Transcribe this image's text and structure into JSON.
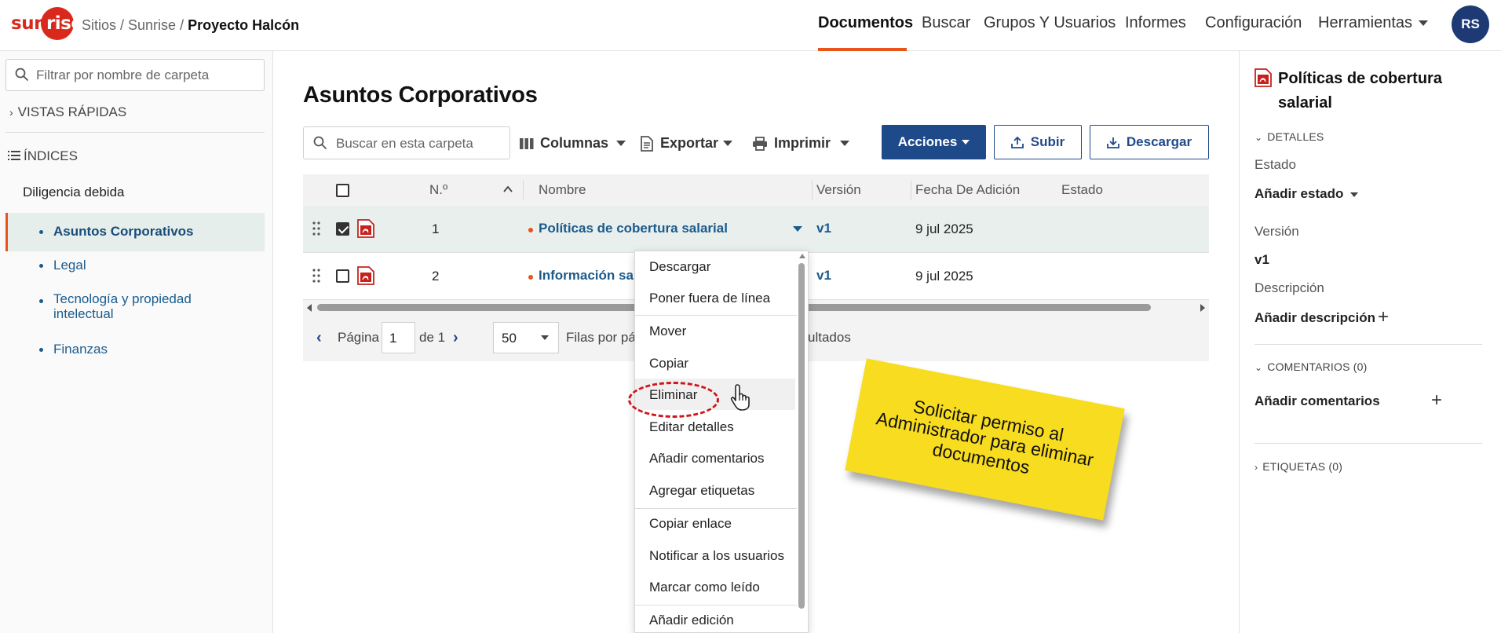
{
  "header": {
    "logo": "sunrise",
    "breadcrumb": {
      "sites": "Sitios",
      "sep1": " / ",
      "site": "Sunrise",
      "sep2": " / ",
      "current": "Proyecto Halcón"
    },
    "nav": [
      "Documentos",
      "Buscar",
      "Grupos Y Usuarios",
      "Informes",
      "Configuración",
      "Herramientas"
    ],
    "active_nav": "Documentos",
    "avatar": "RS",
    "accent_color": "#e8541a",
    "brand_color": "#d9291c"
  },
  "sidebar": {
    "filter_placeholder": "Filtrar por nombre de carpeta",
    "quick_views": "VISTAS RÁPIDAS",
    "indices": "ÍNDICES",
    "root": "Diligencia debida",
    "items": [
      "Asuntos Corporativos",
      "Legal",
      "Tecnología y propiedad intelectual",
      "Finanzas"
    ],
    "selected": "Asuntos Corporativos"
  },
  "main": {
    "title": "Asuntos Corporativos",
    "search_placeholder": "Buscar en esta carpeta",
    "toolbar": {
      "columns": "Columnas",
      "export": "Exportar",
      "print": "Imprimir",
      "actions": "Acciones",
      "upload": "Subir",
      "download": "Descargar"
    },
    "table": {
      "headers": {
        "num": "N.º",
        "name": "Nombre",
        "version": "Versión",
        "date": "Fecha De Adición",
        "status": "Estado"
      },
      "rows": [
        {
          "num": "1",
          "name": "Políticas de cobertura salarial",
          "version": "v1",
          "date": "9 jul 2025",
          "checked": true
        },
        {
          "num": "2",
          "name": "Información sal",
          "version": "v1",
          "date": "9 jul 2025",
          "checked": false
        }
      ]
    },
    "pager": {
      "page_label": "Página",
      "page": "1",
      "of": "de 1",
      "rows": "50",
      "rows_label": "Filas por pá",
      "results": "ultados"
    }
  },
  "context_menu": {
    "items": [
      "Descargar",
      "Poner fuera de línea",
      "Mover",
      "Copiar",
      "Eliminar",
      "Editar detalles",
      "Añadir comentarios",
      "Agregar etiquetas",
      "Copiar enlace",
      "Notificar a los usuarios",
      "Marcar como leído",
      "Añadir edición"
    ],
    "highlighted": "Eliminar"
  },
  "note": {
    "text": "Solicitar permiso al Administrador para eliminar documentos"
  },
  "details_panel": {
    "title": "Políticas de cobertura salarial",
    "details_section": "DETALLES",
    "status_label": "Estado",
    "status_value": "Añadir estado",
    "version_label": "Versión",
    "version_value": "v1",
    "description_label": "Descripción",
    "description_value": "Añadir descripción",
    "comments_section": "COMENTARIOS (0)",
    "comments_add": "Añadir comentarios",
    "tags_section": "ETIQUETAS (0)"
  }
}
